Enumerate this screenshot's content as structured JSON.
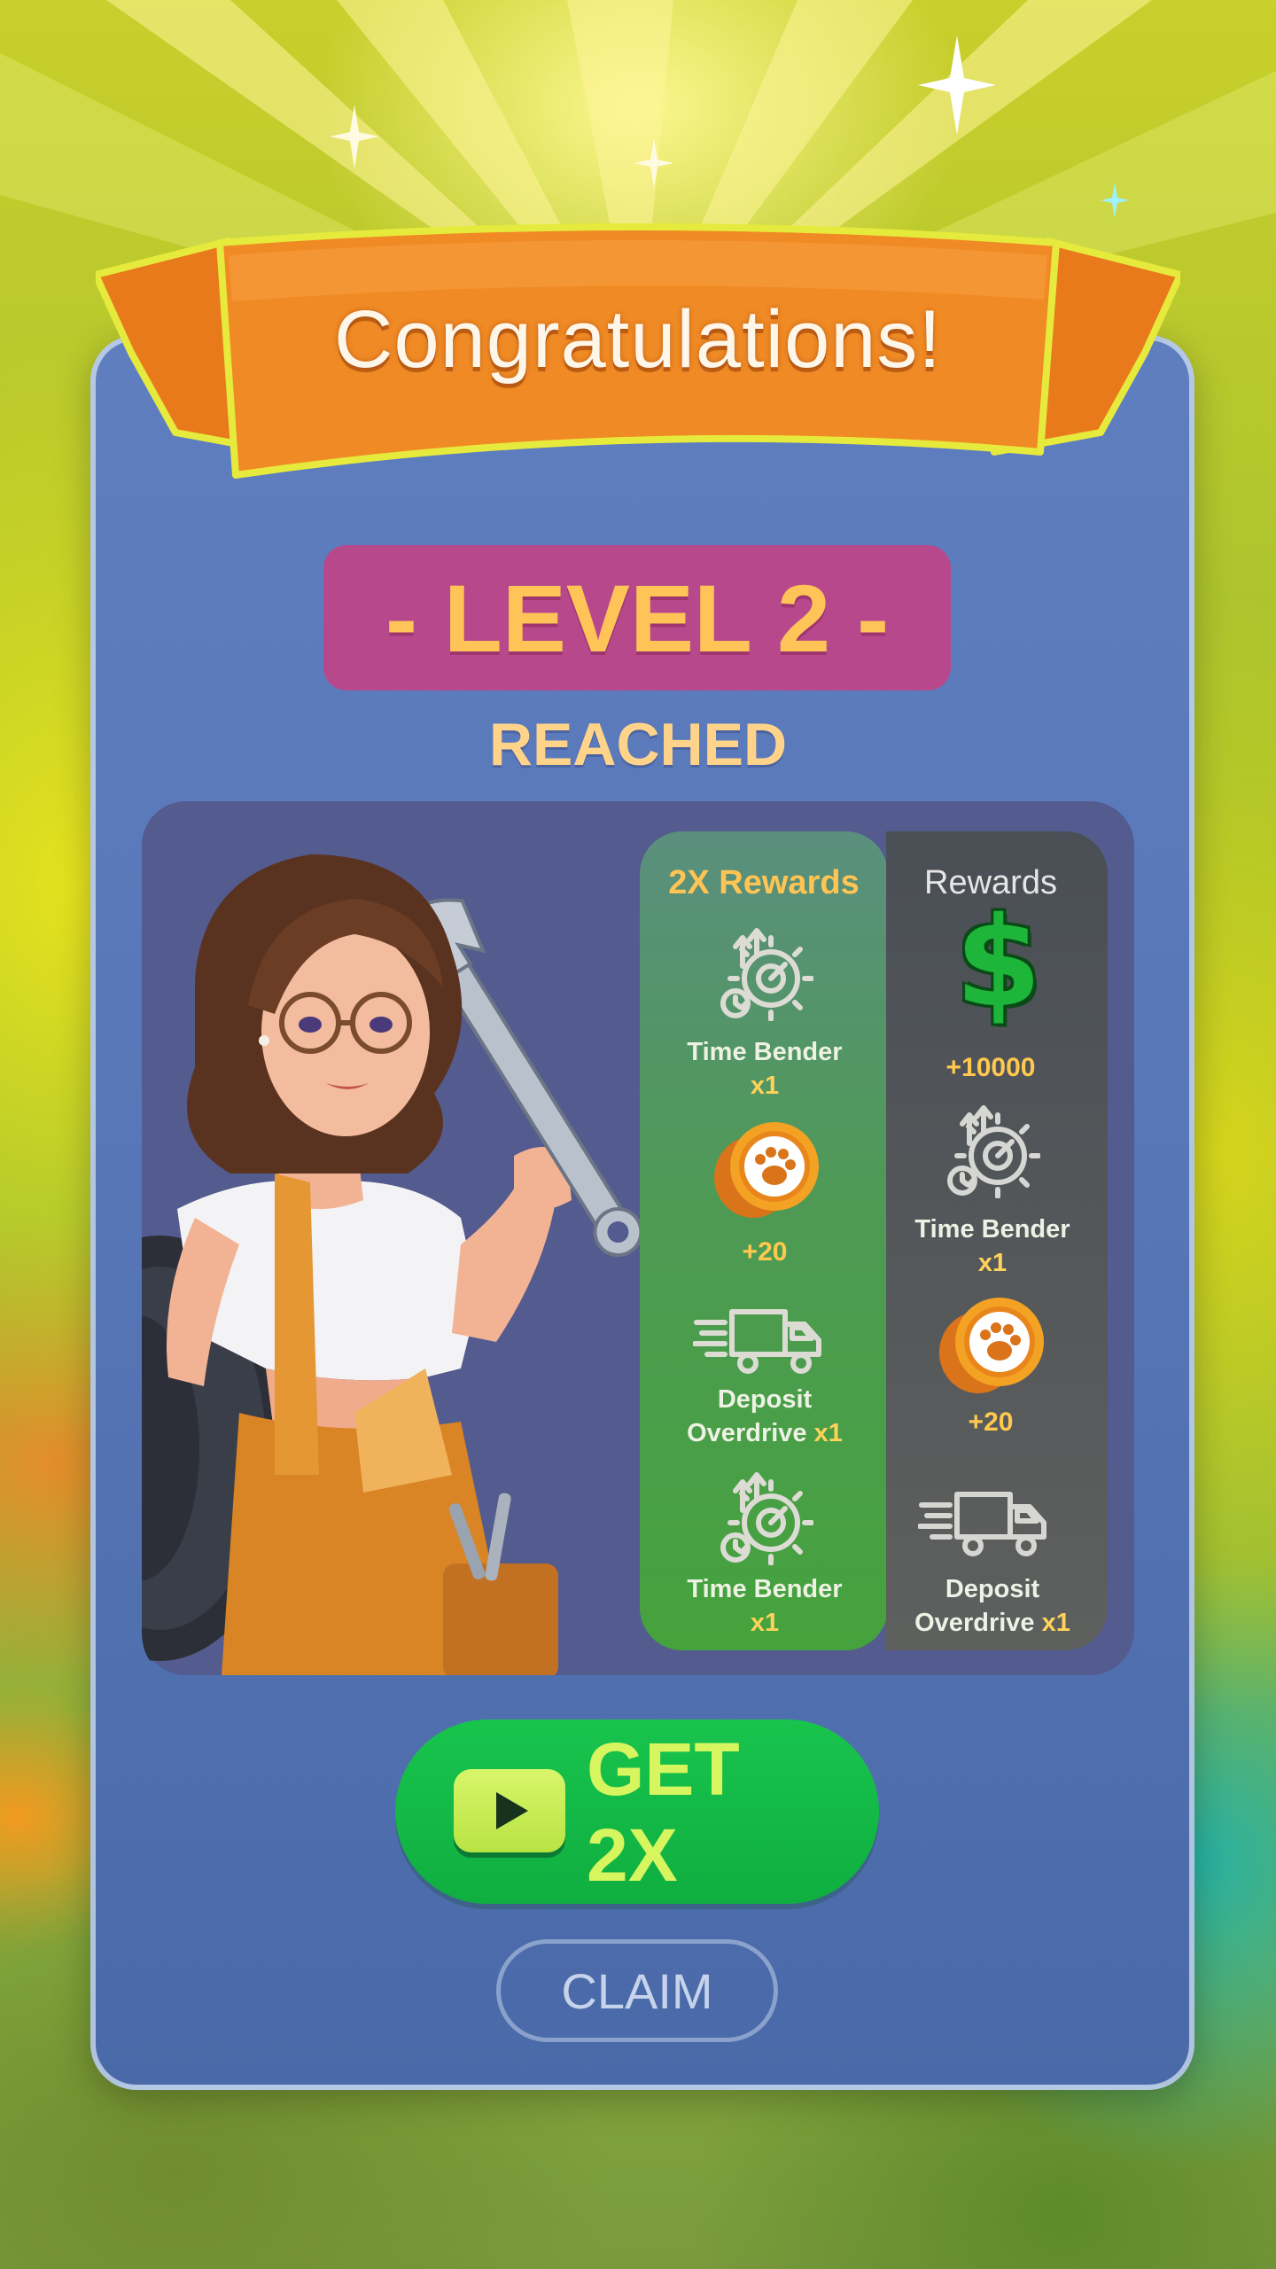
{
  "header": {
    "title": "Congratulations!"
  },
  "level": {
    "badge": "- LEVEL 2 -",
    "subtitle": "REACHED"
  },
  "rewards": {
    "doubled": {
      "heading": "2X Rewards",
      "items": [
        {
          "icon": "time-bender-gear-icon",
          "name": "Time Bender",
          "qty": "x1"
        },
        {
          "icon": "paw-coin-icon",
          "amount": "+20"
        },
        {
          "icon": "deposit-overdrive-truck-icon",
          "name_line1": "Deposit",
          "name_line2": "Overdrive",
          "qty": "x1"
        },
        {
          "icon": "time-bender-gear-icon",
          "name": "Time Bender",
          "qty": "x1"
        }
      ]
    },
    "base": {
      "heading": "Rewards",
      "items": [
        {
          "icon": "dollar-sign-icon",
          "symbol": "$",
          "amount": "+10000"
        },
        {
          "icon": "time-bender-gear-icon",
          "name": "Time Bender",
          "qty": "x1"
        },
        {
          "icon": "paw-coin-icon",
          "amount": "+20"
        },
        {
          "icon": "deposit-overdrive-truck-icon",
          "name_line1": "Deposit",
          "name_line2": "Overdrive",
          "qty": "x1"
        }
      ]
    }
  },
  "actions": {
    "get_2x_label": "GET 2X",
    "claim_label": "CLAIM"
  },
  "colors": {
    "panel": "#5777b8",
    "ribbon": "#f08a24",
    "level_pill": "#b8488c",
    "gold_text": "#ffc458",
    "get2x_button": "#12b845",
    "claim_outline": "#a0b4d7"
  }
}
